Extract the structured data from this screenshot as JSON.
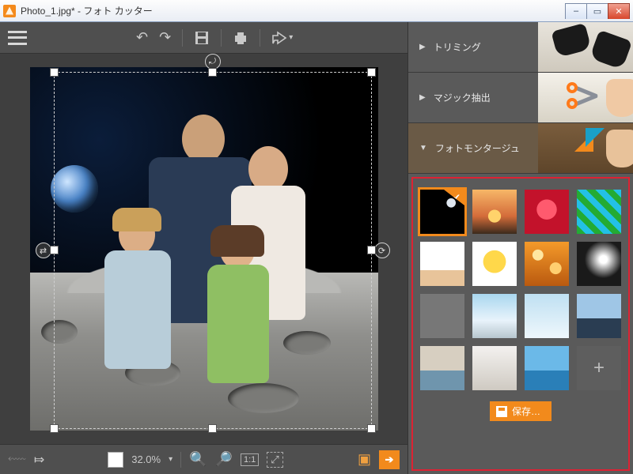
{
  "window": {
    "title": "Photo_1.jpg* - フォト カッター",
    "min": "–",
    "max": "▭",
    "close": "✕"
  },
  "toolbar": {
    "menu_name": "menu",
    "undo": "↶",
    "redo": "↷",
    "save": "💾",
    "print": "🖨",
    "share": "↗"
  },
  "status": {
    "prev": "◀",
    "next": "▶",
    "zoom_value": "32.0%",
    "zoom_drop": "▾",
    "zoom_out": "⊖",
    "zoom_in": "⊕",
    "fit_1_1": "1:1",
    "fit_screen": "⤢",
    "compare": "▣",
    "export": "➜"
  },
  "panels": {
    "trim": {
      "label": "トリミング",
      "chev": "▶"
    },
    "magic": {
      "label": "マジック抽出",
      "chev": "▶"
    },
    "montage": {
      "label": "フォトモンタージュ",
      "chev": "▼"
    }
  },
  "montage": {
    "save_label": "保存…",
    "templates": [
      {
        "name": "moon",
        "selected": true
      },
      {
        "name": "sunset-tree",
        "selected": false
      },
      {
        "name": "red-heart",
        "selected": false
      },
      {
        "name": "comic-pop",
        "selected": false
      },
      {
        "name": "white-cat",
        "selected": false
      },
      {
        "name": "cartoon-monster",
        "selected": false
      },
      {
        "name": "orange-bokeh",
        "selected": false
      },
      {
        "name": "spotlight",
        "selected": false
      },
      {
        "name": "cow-field",
        "selected": false
      },
      {
        "name": "eiffel",
        "selected": false
      },
      {
        "name": "snowman",
        "selected": false
      },
      {
        "name": "city-skyline",
        "selected": false
      },
      {
        "name": "venice",
        "selected": false
      },
      {
        "name": "winter-trees",
        "selected": false
      },
      {
        "name": "tropical-beach",
        "selected": false
      }
    ]
  }
}
